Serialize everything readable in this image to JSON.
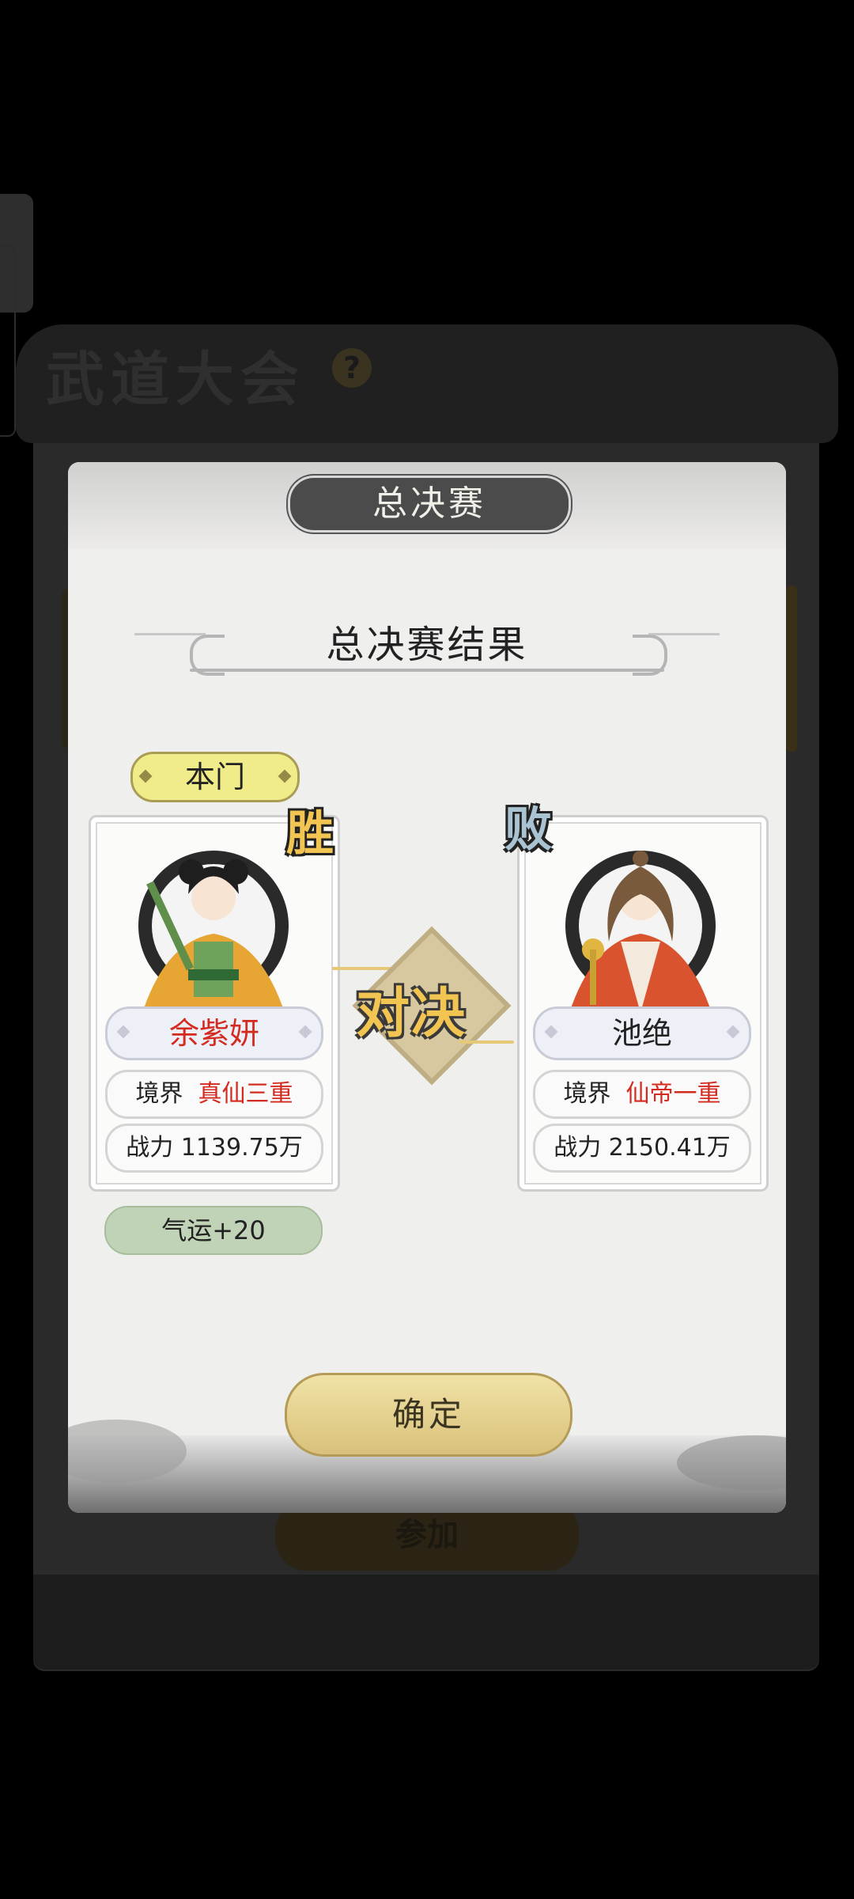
{
  "background": {
    "title": "武道大会",
    "help_icon": "?",
    "join_button": "参加"
  },
  "modal": {
    "tab_title": "总决赛",
    "result_title": "总决赛结果",
    "faction_tag": "本门",
    "vs_label": "对决",
    "confirm_button": "确定",
    "fortune_reward": "气运+20"
  },
  "fighters": {
    "left": {
      "result": "胜",
      "name": "余紫妍",
      "realm_label": "境界",
      "realm_value": "真仙三重",
      "power": "战力 1139.75万"
    },
    "right": {
      "result": "败",
      "name": "池绝",
      "realm_label": "境界",
      "realm_value": "仙帝一重",
      "power": "战力 2150.41万"
    }
  },
  "colors": {
    "name_red": "#d32b20",
    "gold": "#f2c552",
    "lose_blue": "#a9c3d2"
  }
}
